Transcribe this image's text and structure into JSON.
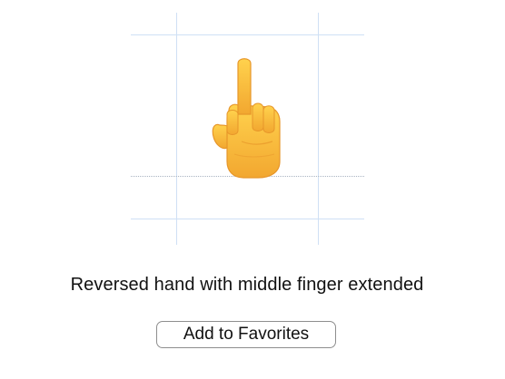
{
  "glyph": {
    "icon": "reversed-hand-middle-finger-extended-emoji",
    "colors": {
      "skin": "#f8c23a",
      "skin_shadow": "#e7962a",
      "guides": "#cfe0f5",
      "baseline": "#a9b4c2"
    }
  },
  "description": "Reversed hand with middle finger extended",
  "actions": {
    "favorites_label": "Add to Favorites"
  }
}
